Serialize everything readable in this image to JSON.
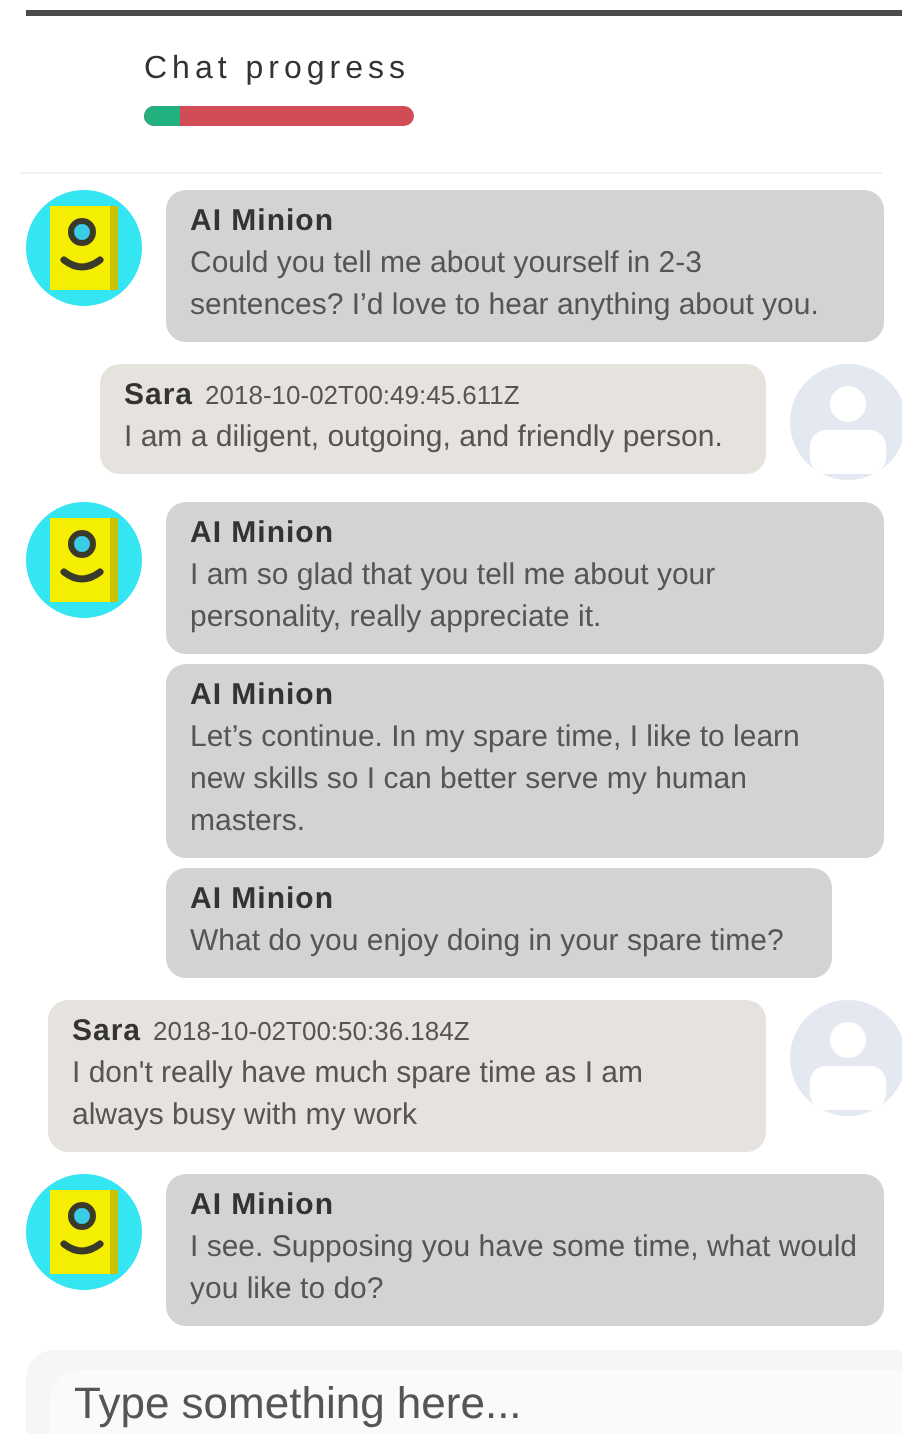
{
  "progress": {
    "label": "Chat progress",
    "level": 0.13
  },
  "messages": [
    {
      "kind": "bot",
      "items": [
        {
          "sender": "AI Minion",
          "text": "Could you tell me about yourself in 2-3 sentences? I’d love to hear anything about you."
        }
      ]
    },
    {
      "kind": "user",
      "items": [
        {
          "sender": "Sara",
          "time": "2018-10-02T00:49:45.611Z",
          "text": "I am a diligent, outgoing, and friendly person."
        }
      ]
    },
    {
      "kind": "bot",
      "items": [
        {
          "sender": "AI Minion",
          "text": "I am so glad that you tell me about your personality, really appreciate it."
        },
        {
          "sender": "AI Minion",
          "text": "Let’s continue. In my spare time, I like to learn new skills so I can better serve my human masters."
        },
        {
          "sender": "AI Minion",
          "text": "What do you enjoy doing in your spare time?"
        }
      ]
    },
    {
      "kind": "user",
      "items": [
        {
          "sender": "Sara",
          "time": "2018-10-02T00:50:36.184Z",
          "text": "I don't really have much spare time as I am always busy with my work"
        }
      ]
    },
    {
      "kind": "bot",
      "items": [
        {
          "sender": "AI Minion",
          "text": "I see. Supposing you have some time, what would you like to do?"
        }
      ]
    }
  ],
  "composer": {
    "placeholder": "Type something here..."
  }
}
